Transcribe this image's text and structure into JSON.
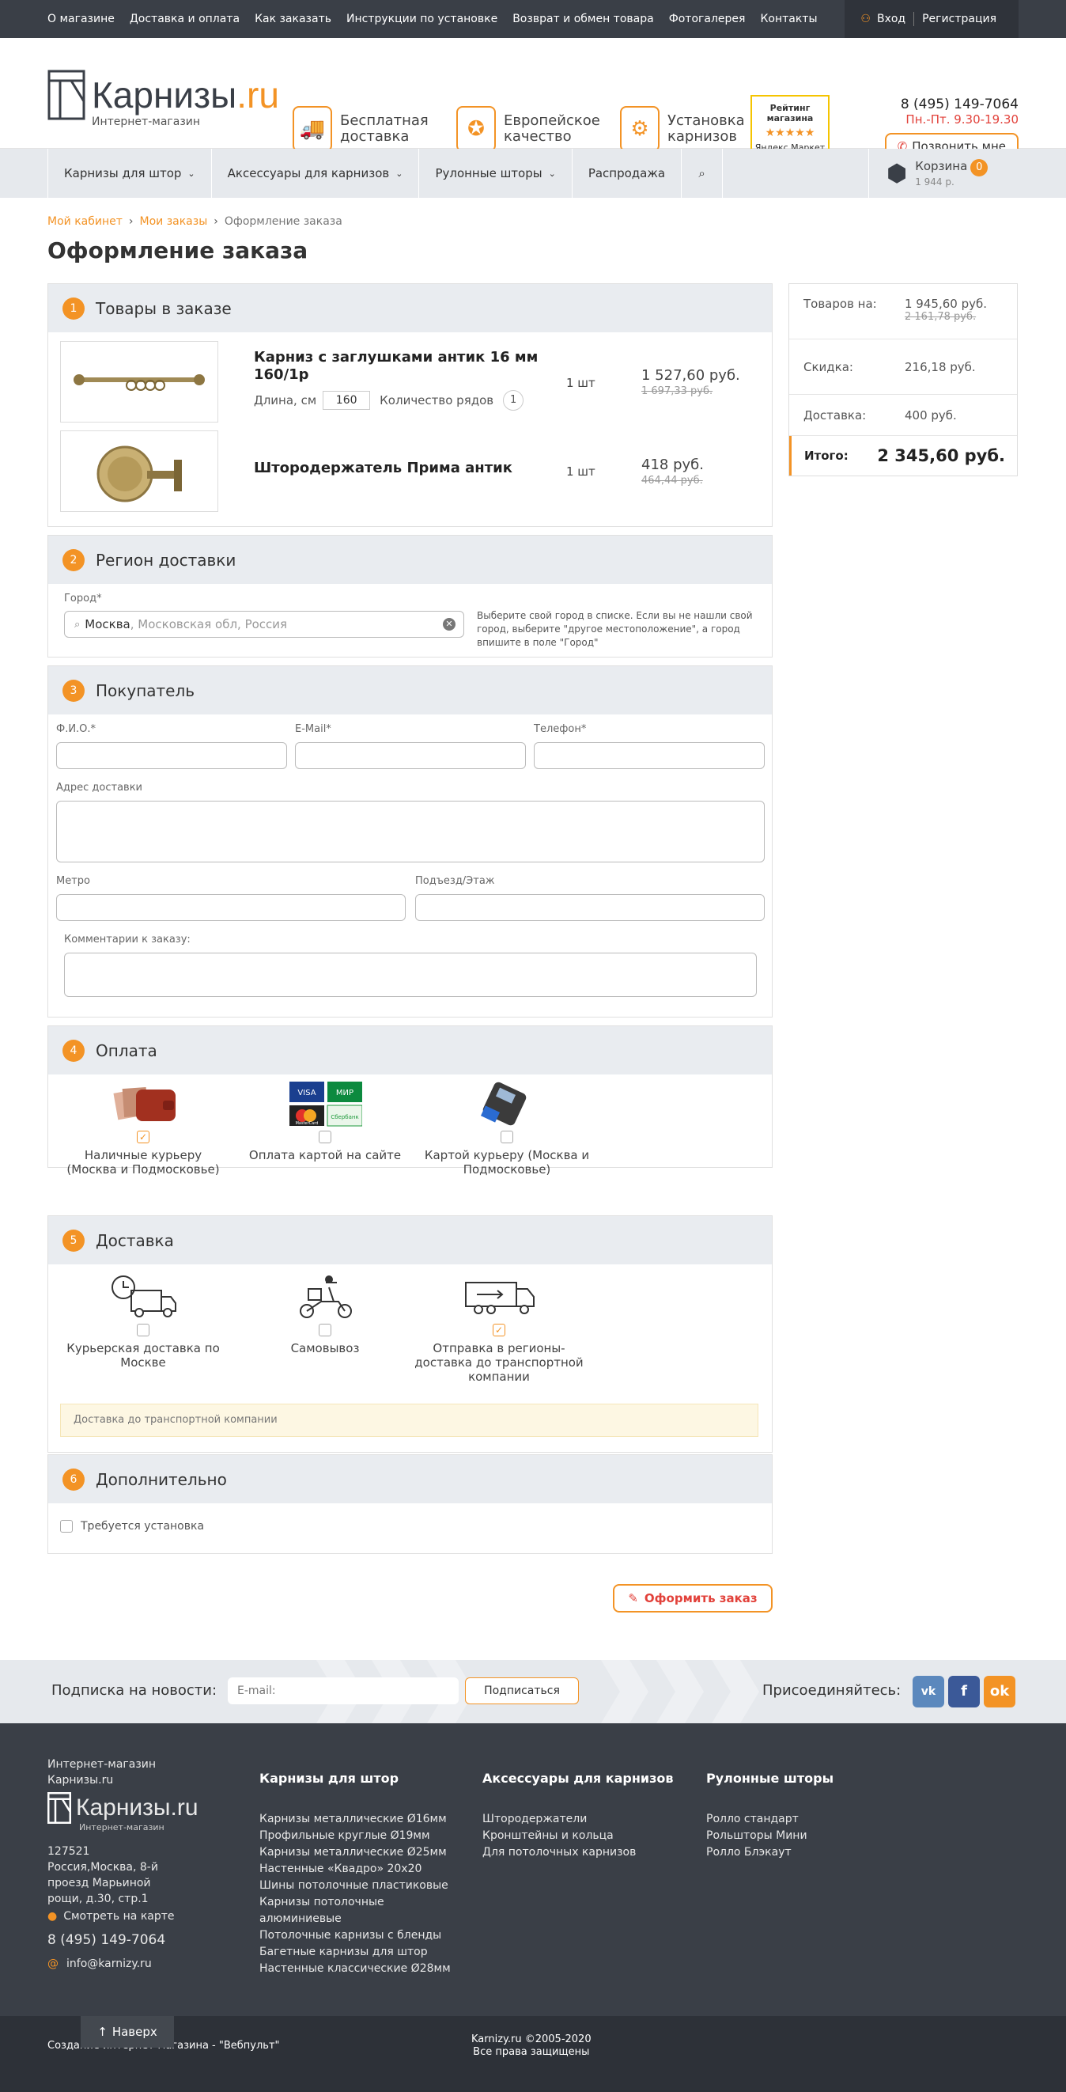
{
  "topnav": [
    "О магазине",
    "Доставка и оплата",
    "Как заказать",
    "Инструкции по установке",
    "Возврат и обмен товара",
    "Фотогалерея",
    "Контакты"
  ],
  "auth": {
    "login": "Вход",
    "register": "Регистрация"
  },
  "logo": {
    "name": "Карнизы",
    "tld": ".ru",
    "sub": "Интернет-магазин"
  },
  "features": [
    {
      "line1": "Бесплатная",
      "line2": "доставка"
    },
    {
      "line1": "Европейское",
      "line2": "качество"
    },
    {
      "line1": "Установка",
      "line2": "карнизов"
    }
  ],
  "rating": {
    "line1": "Рейтинг",
    "line2": "магазина",
    "stars": "★★★★★",
    "market": "Яндекс Маркет"
  },
  "contact": {
    "phone": "8 (495) 149-7064",
    "hours": "Пн.-Пт. 9.30-19.30",
    "call": "Позвонить мне"
  },
  "mainnav": [
    "Карнизы для штор",
    "Аксессуары для карнизов",
    "Рулонные шторы",
    "Распродажа"
  ],
  "cart": {
    "label": "Корзина",
    "count": "0",
    "sum": "1 944 р."
  },
  "breadcrumbs": [
    "Мой кабинет",
    "Мои заказы",
    "Оформление заказа"
  ],
  "page_title": "Оформление заказа",
  "s1": {
    "num": "1",
    "title": "Товары в заказе",
    "items": [
      {
        "name": "Карниз с заглушками антик 16 мм 160/1р",
        "len_label": "Длина, см",
        "len": "160",
        "rows_label": "Количество рядов",
        "rows": "1",
        "qty": "1 шт",
        "price": "1 527,60 руб.",
        "old": "1 697,33 руб."
      },
      {
        "name": "Штородержатель Прима антик",
        "qty": "1 шт",
        "price": "418 руб.",
        "old": "464,44 руб."
      }
    ]
  },
  "s2": {
    "num": "2",
    "title": "Регион доставки",
    "city_label": "Город*",
    "city": "Москва",
    "city_region": ", Московская обл, Россия",
    "hint": "Выберите свой город в списке. Если вы не нашли свой город, выберите \"другое местоположение\", а город впишите в поле \"Город\""
  },
  "s3": {
    "num": "3",
    "title": "Покупатель",
    "fio": "Ф.И.О.*",
    "email": "E-Mail*",
    "phone": "Телефон*",
    "address": "Адрес доставки",
    "metro": "Метро",
    "entrance": "Подъезд/Этаж",
    "comment": "Комментарии к заказу:"
  },
  "s4": {
    "num": "4",
    "title": "Оплата",
    "options": [
      "Наличные курьеру (Москва и Подмосковье)",
      "Оплата картой на сайте",
      "Картой курьеру (Москва и Подмосковье)"
    ],
    "card_visa": "VISA",
    "card_mir": "МИР",
    "card_mc": "MasterCard",
    "card_sber": "Сбербанк"
  },
  "s5": {
    "num": "5",
    "title": "Доставка",
    "options": [
      "Курьерская доставка по Москве",
      "Самовывоз",
      "Отправка в регионы-доставка до транспортной компании"
    ],
    "note": "Доставка до транспортной компании"
  },
  "s6": {
    "num": "6",
    "title": "Дополнительно",
    "install": "Требуется установка"
  },
  "summary": {
    "goods_k": "Товаров на:",
    "goods_v": "1 945,60 руб.",
    "goods_old": "2 161,78 руб.",
    "disc_k": "Скидка:",
    "disc_v": "216,18 руб.",
    "del_k": "Доставка:",
    "del_v": "400 руб.",
    "total_k": "Итого:",
    "total_v": "2 345,60 руб."
  },
  "order_btn": "Оформить заказ",
  "subscribe": {
    "label": "Подписка на новости:",
    "placeholder": "E-mail:",
    "btn": "Подписаться",
    "join": "Присоединяйтесь:"
  },
  "footer": {
    "shop1": "Интернет-магазин",
    "shop2": "Карнизы.ru",
    "logo": "Карнизы.ru",
    "logo_sub": "Интернет-магазин",
    "addr": "127521 Россия,Москва, 8-й проезд Марьиной рощи, д.30, стр.1",
    "map": "Смотреть на карте",
    "phone": "8 (495) 149-7064",
    "email": "info@karnizy.ru",
    "col1": {
      "title": "Карнизы для штор",
      "items": [
        "Карнизы металлические Ø16мм",
        "Профильные круглые Ø19мм",
        "Карнизы металлические Ø25мм",
        "Настенные «Квадро» 20х20",
        "Шины потолочные пластиковые",
        "Карнизы потолочные алюминиевые",
        "Потолочные карнизы с бленды",
        "Багетные карнизы для штор",
        "Настенные классические Ø28мм"
      ]
    },
    "col2": {
      "title": "Аксессуары для карнизов",
      "items": [
        "Штородержатели",
        "Кронштейны и кольца",
        "Для потолочных карнизов"
      ]
    },
    "col3": {
      "title": "Рулонные шторы",
      "items": [
        "Ролло стандарт",
        "Рольшторы Мини",
        "Ролло Блэкаут"
      ]
    }
  },
  "bottom": {
    "created": "Создание интернет-магазина - \"Вебпульт\"",
    "copy": "Karnizy.ru ©2005-2020",
    "rights": "Все права защищены",
    "up": "Наверх"
  }
}
